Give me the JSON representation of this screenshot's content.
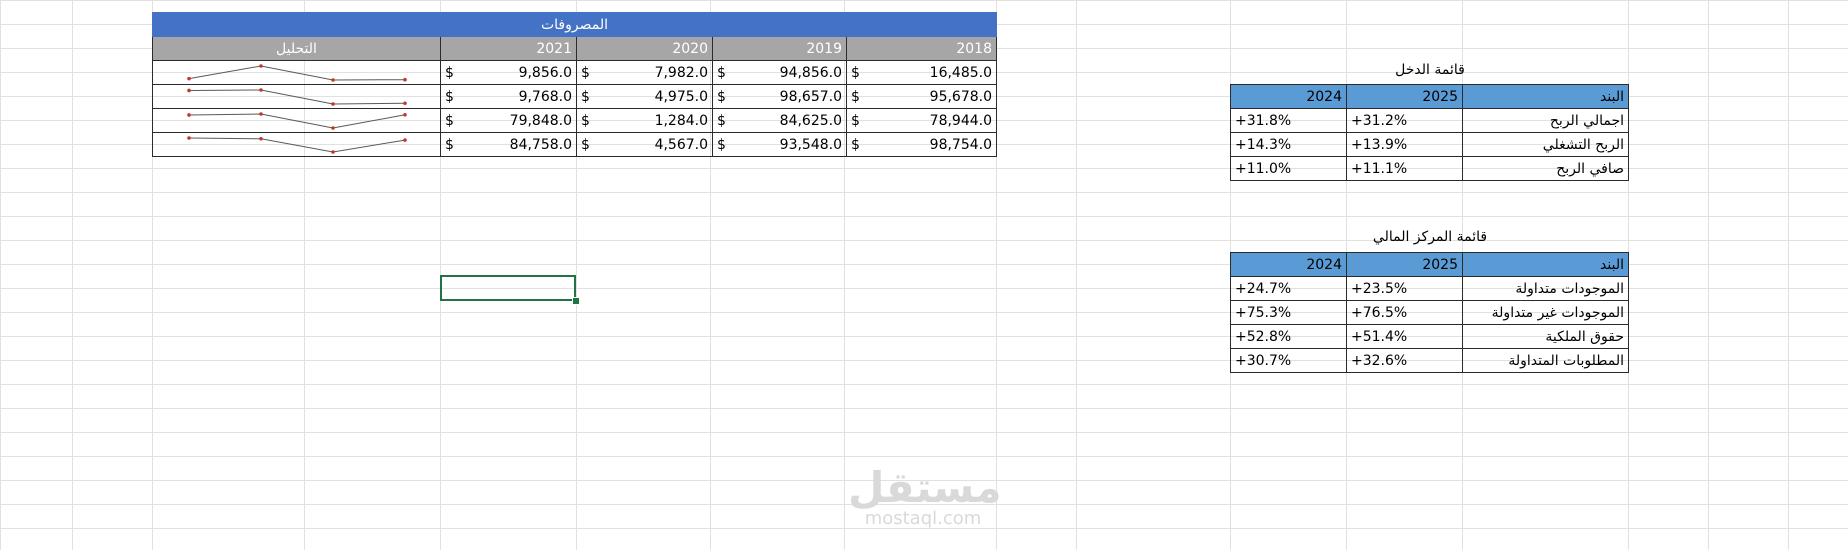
{
  "expenses": {
    "title": "المصروفات",
    "analysis_header": "التحليل",
    "years": [
      "2021",
      "2020",
      "2019",
      "2018"
    ],
    "currency": "$",
    "rows": [
      {
        "y2021": "9,856.0",
        "y2020": "7,982.0",
        "y2019": "94,856.0",
        "y2018": "16,485.0",
        "trend": [
          16485,
          94856,
          7982,
          9856
        ]
      },
      {
        "y2021": "9,768.0",
        "y2020": "4,975.0",
        "y2019": "98,657.0",
        "y2018": "95,678.0",
        "trend": [
          95678,
          98657,
          4975,
          9768
        ]
      },
      {
        "y2021": "79,848.0",
        "y2020": "1,284.0",
        "y2019": "84,625.0",
        "y2018": "78,944.0",
        "trend": [
          78944,
          84625,
          1284,
          79848
        ]
      },
      {
        "y2021": "84,758.0",
        "y2020": "4,567.0",
        "y2019": "93,548.0",
        "y2018": "98,754.0",
        "trend": [
          98754,
          93548,
          4567,
          84758
        ]
      }
    ]
  },
  "income_statement": {
    "title": "قائمة الدخل",
    "headers": {
      "item": "البند",
      "y2025": "2025",
      "y2024": "2024"
    },
    "rows": [
      {
        "item": "اجمالي الربح",
        "y2025": "+31.2%",
        "y2024": "+31.8%"
      },
      {
        "item": "الربح التشغلي",
        "y2025": "+13.9%",
        "y2024": "+14.3%"
      },
      {
        "item": "صافي الربح",
        "y2025": "+11.1%",
        "y2024": "+11.0%"
      }
    ]
  },
  "financial_position": {
    "title": "قائمة المركز المالي",
    "headers": {
      "item": "البند",
      "y2025": "2025",
      "y2024": "2024"
    },
    "rows": [
      {
        "item": "الموجودات  متداولة",
        "y2025": "+23.5%",
        "y2024": "+24.7%"
      },
      {
        "item": "الموجودات غير متداولة",
        "y2025": "+76.5%",
        "y2024": "+75.3%"
      },
      {
        "item": " حقوق الملكية",
        "y2025": "+51.4%",
        "y2024": "+52.8%"
      },
      {
        "item": "المطلوبات المتداولة",
        "y2025": "+32.6%",
        "y2024": "+30.7%"
      }
    ]
  },
  "watermark": {
    "arabic": "مستقل",
    "latin": "mostaql.com"
  },
  "colors": {
    "title_blue": "#4472c4",
    "header_gray": "#a6a6a6",
    "header_light_blue": "#5b9bd5",
    "sparkline": "#595959",
    "marker": "#c0392b",
    "selection": "#217346"
  }
}
